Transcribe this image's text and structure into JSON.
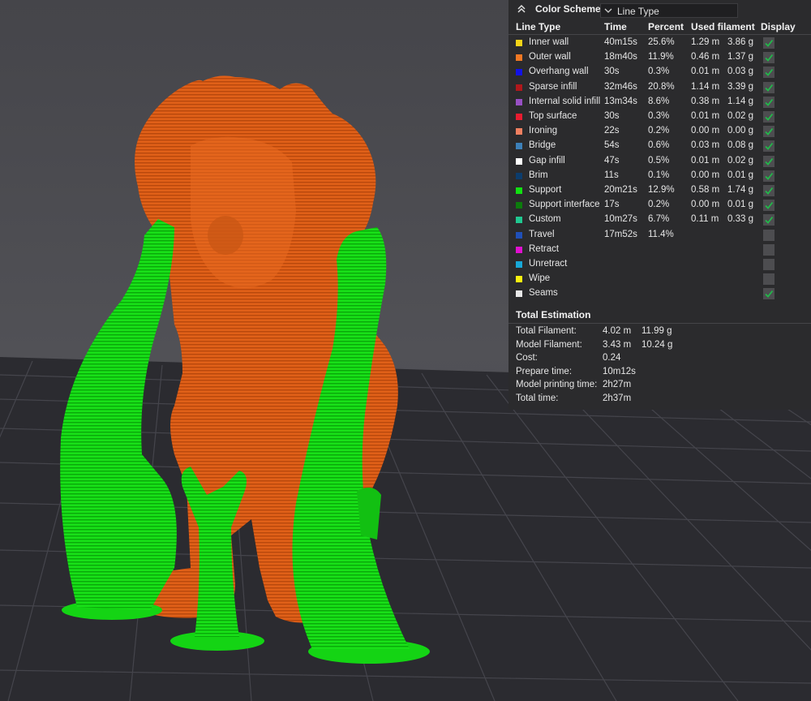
{
  "panel": {
    "title": "Color Scheme",
    "scheme_value": "Line Type",
    "columns": [
      "Line Type",
      "Time",
      "Percent",
      "Used filament",
      "Display"
    ],
    "rows": [
      {
        "name": "Inner wall",
        "time": "40m15s",
        "percent": "25.6%",
        "length": "1.29 m",
        "weight": "3.86 g",
        "color": "#f5d418",
        "display": true
      },
      {
        "name": "Outer wall",
        "time": "18m40s",
        "percent": "11.9%",
        "length": "0.46 m",
        "weight": "1.37 g",
        "color": "#f07824",
        "display": true
      },
      {
        "name": "Overhang wall",
        "time": "30s",
        "percent": "0.3%",
        "length": "0.01 m",
        "weight": "0.03 g",
        "color": "#1212e6",
        "display": true
      },
      {
        "name": "Sparse infill",
        "time": "32m46s",
        "percent": "20.8%",
        "length": "1.14 m",
        "weight": "3.39 g",
        "color": "#b0181c",
        "display": true
      },
      {
        "name": "Internal solid infill",
        "time": "13m34s",
        "percent": "8.6%",
        "length": "0.38 m",
        "weight": "1.14 g",
        "color": "#9850c4",
        "display": true
      },
      {
        "name": "Top surface",
        "time": "30s",
        "percent": "0.3%",
        "length": "0.01 m",
        "weight": "0.02 g",
        "color": "#e81c30",
        "display": true
      },
      {
        "name": "Ironing",
        "time": "22s",
        "percent": "0.2%",
        "length": "0.00 m",
        "weight": "0.00 g",
        "color": "#f08060",
        "display": true
      },
      {
        "name": "Bridge",
        "time": "54s",
        "percent": "0.6%",
        "length": "0.03 m",
        "weight": "0.08 g",
        "color": "#3c80b8",
        "display": true
      },
      {
        "name": "Gap infill",
        "time": "47s",
        "percent": "0.5%",
        "length": "0.01 m",
        "weight": "0.02 g",
        "color": "#ffffff",
        "display": true
      },
      {
        "name": "Brim",
        "time": "11s",
        "percent": "0.1%",
        "length": "0.00 m",
        "weight": "0.01 g",
        "color": "#0c3c6c",
        "display": true
      },
      {
        "name": "Support",
        "time": "20m21s",
        "percent": "12.9%",
        "length": "0.58 m",
        "weight": "1.74 g",
        "color": "#12e012",
        "display": true
      },
      {
        "name": "Support interface",
        "time": "17s",
        "percent": "0.2%",
        "length": "0.00 m",
        "weight": "0.01 g",
        "color": "#0c7c0c",
        "display": true
      },
      {
        "name": "Custom",
        "time": "10m27s",
        "percent": "6.7%",
        "length": "0.11 m",
        "weight": "0.33 g",
        "color": "#20c890",
        "display": true
      },
      {
        "name": "Travel",
        "time": "17m52s",
        "percent": "11.4%",
        "length": "",
        "weight": "",
        "color": "#2050b8",
        "display": false
      },
      {
        "name": "Retract",
        "time": "",
        "percent": "",
        "length": "",
        "weight": "",
        "color": "#e010d0",
        "display": false
      },
      {
        "name": "Unretract",
        "time": "",
        "percent": "",
        "length": "",
        "weight": "",
        "color": "#18a8d8",
        "display": false
      },
      {
        "name": "Wipe",
        "time": "",
        "percent": "",
        "length": "",
        "weight": "",
        "color": "#f8f010",
        "display": false
      },
      {
        "name": "Seams",
        "time": "",
        "percent": "",
        "length": "",
        "weight": "",
        "color": "#e8e8e8",
        "display": true
      }
    ],
    "total_title": "Total Estimation",
    "totals": [
      {
        "label": "Total Filament:",
        "v1": "4.02 m",
        "v2": "11.99 g"
      },
      {
        "label": "Model Filament:",
        "v1": "3.43 m",
        "v2": "10.24 g"
      },
      {
        "label": "Cost:",
        "v1": "0.24",
        "v2": ""
      },
      {
        "label": "Prepare time:",
        "v1": "10m12s",
        "v2": ""
      },
      {
        "label": "Model printing time:",
        "v1": "2h27m",
        "v2": ""
      },
      {
        "label": "Total time:",
        "v1": "2h37m",
        "v2": ""
      }
    ],
    "check_color": "#22b84a"
  }
}
